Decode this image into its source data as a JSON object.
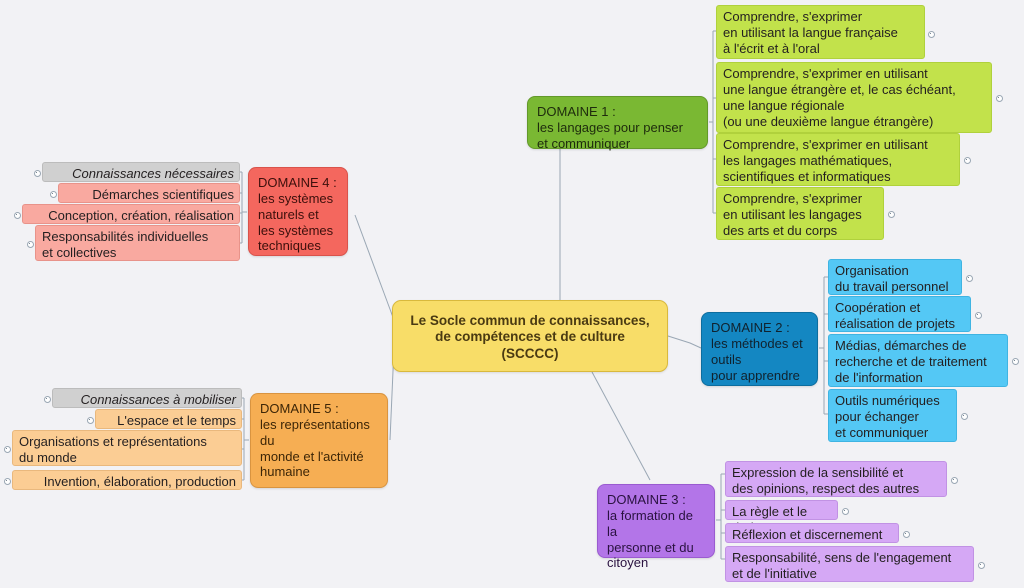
{
  "diagram": {
    "type": "mind-map",
    "title": "Le Socle commun de connaissances, de compétences et de culture (SCCCC)",
    "background_color": "#f2f2f5",
    "root": {
      "label": "Le Socle commun de connaissances,\nde compétences et de culture\n(SCCCC)",
      "color": "#f8dd68"
    },
    "branches": [
      {
        "id": "domaine-1",
        "label": "DOMAINE 1 :\nles langages pour penser\net communiquer",
        "color": "#7ab833",
        "leaf_color": "#c2e24b",
        "side": "right",
        "leaves": [
          {
            "label": "Comprendre, s'exprimer\nen utilisant la langue française\nà l'écrit et à l'oral"
          },
          {
            "label": "Comprendre, s'exprimer en utilisant\nune langue étrangère et, le cas échéant,\nune langue régionale\n(ou une deuxième langue étrangère)"
          },
          {
            "label": "Comprendre, s'exprimer en utilisant\nles langages mathématiques,\nscientifiques et informatiques"
          },
          {
            "label": "Comprendre, s'exprimer\nen utilisant les langages\ndes arts et du corps"
          }
        ]
      },
      {
        "id": "domaine-2",
        "label": "DOMAINE 2 :\nles méthodes et outils\npour apprendre",
        "color": "#1487c2",
        "leaf_color": "#54c8f5",
        "side": "right",
        "leaves": [
          {
            "label": "Organisation\ndu travail personnel"
          },
          {
            "label": "Coopération et\nréalisation de projets"
          },
          {
            "label": "Médias, démarches de\nrecherche et de traitement\nde l'information"
          },
          {
            "label": "Outils numériques\npour échanger\net communiquer"
          }
        ]
      },
      {
        "id": "domaine-3",
        "label": "DOMAINE 3 :\nla formation de la\npersonne et du\ncitoyen",
        "color": "#b375e8",
        "leaf_color": "#d5a8f5",
        "side": "right",
        "leaves": [
          {
            "label": "Expression de la sensibilité et\ndes opinions, respect des autres"
          },
          {
            "label": "La règle et le droit"
          },
          {
            "label": "Réflexion et discernement"
          },
          {
            "label": "Responsabilité, sens de l'engagement\net de l'initiative"
          }
        ]
      },
      {
        "id": "domaine-4",
        "label": "DOMAINE 4 :\nles systèmes\nnaturels et\nles systèmes\ntechniques",
        "color": "#f4675e",
        "leaf_color": "#f9a9a0",
        "side": "left",
        "leaves": [
          {
            "label": "Connaissances nécessaires",
            "style": "gray-italic"
          },
          {
            "label": "Démarches scientifiques"
          },
          {
            "label": "Conception, création, réalisation"
          },
          {
            "label": "Responsabilités individuelles\net collectives"
          }
        ]
      },
      {
        "id": "domaine-5",
        "label": "DOMAINE 5 :\nles représentations du\nmonde et l'activité\nhumaine",
        "color": "#f6ae53",
        "leaf_color": "#fbcd94",
        "side": "left",
        "leaves": [
          {
            "label": "Connaissances à mobiliser",
            "style": "gray-italic"
          },
          {
            "label": "L'espace et le temps"
          },
          {
            "label": "Organisations et représentations\ndu monde"
          },
          {
            "label": "Invention, élaboration, production"
          }
        ]
      }
    ]
  }
}
